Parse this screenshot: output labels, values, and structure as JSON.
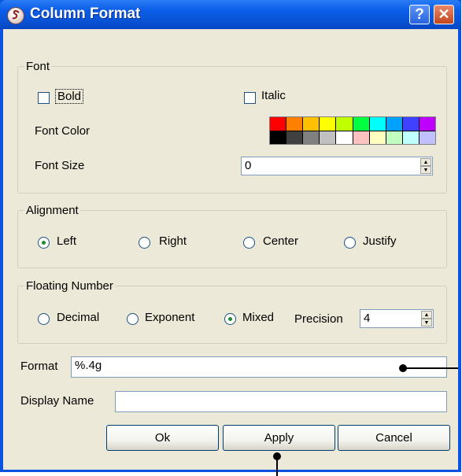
{
  "window": {
    "title": "Column Format",
    "help_label": "?",
    "close_label": "✕"
  },
  "font_group": {
    "legend": "Font",
    "bold_label": "Bold",
    "bold_checked": false,
    "italic_label": "Italic",
    "italic_checked": false,
    "color_label": "Font Color",
    "palette": [
      "#ff0000",
      "#ff8000",
      "#ffc000",
      "#ffff00",
      "#c0ff00",
      "#00ff40",
      "#00ffff",
      "#00a0ff",
      "#4040ff",
      "#c000ff",
      "#000000",
      "#404040",
      "#808080",
      "#c0c0c0",
      "#ffffff",
      "#ffc0c0",
      "#ffffc0",
      "#c0ffc0",
      "#c0ffff",
      "#c0c0ff"
    ],
    "size_label": "Font Size",
    "size_value": "0"
  },
  "alignment_group": {
    "legend": "Alignment",
    "options": [
      "Left",
      "Right",
      "Center",
      "Justify"
    ],
    "selected": "Left"
  },
  "floating_group": {
    "legend": "Floating Number",
    "options": [
      "Decimal",
      "Exponent",
      "Mixed"
    ],
    "selected": "Mixed",
    "precision_label": "Precision",
    "precision_value": "4"
  },
  "format_label": "Format",
  "format_value": "%.4g",
  "display_name_label": "Display Name",
  "display_name_value": "",
  "buttons": {
    "ok": "Ok",
    "apply": "Apply",
    "cancel": "Cancel"
  }
}
